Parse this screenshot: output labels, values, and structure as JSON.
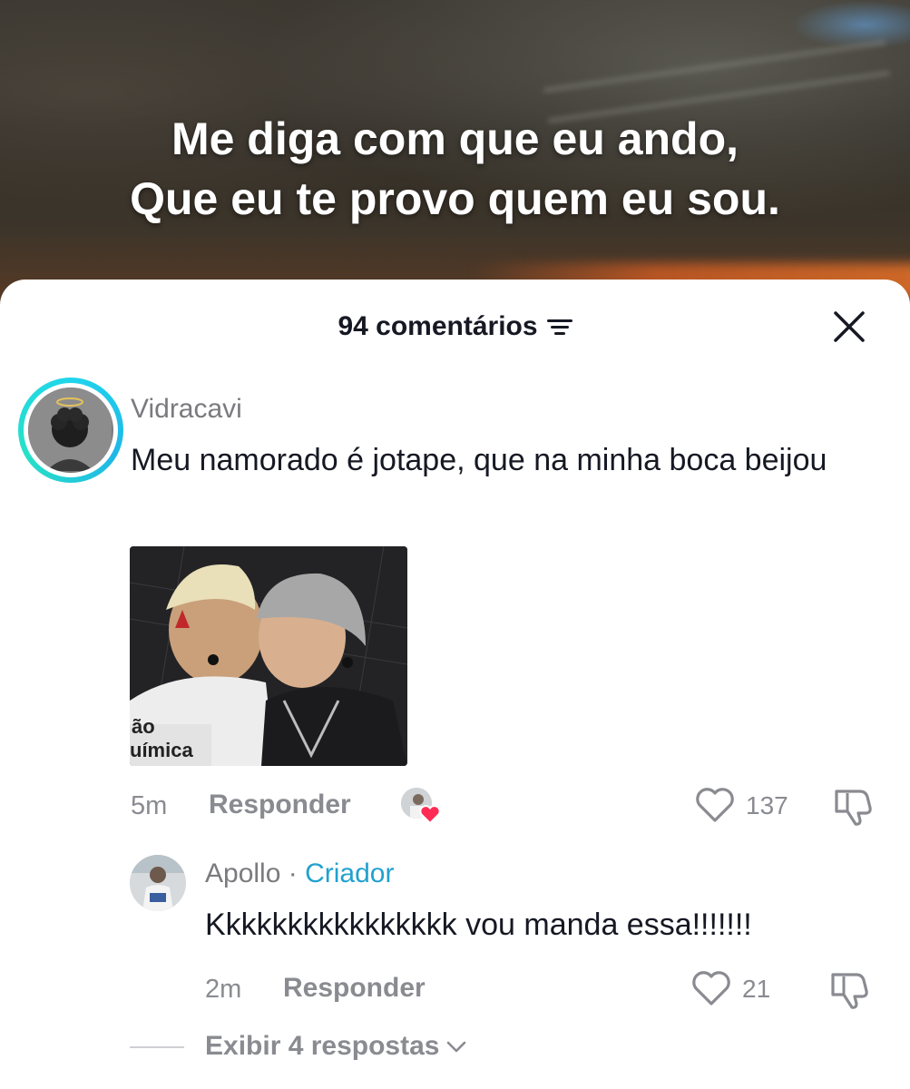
{
  "video": {
    "lyrics_line1": "Me diga com que eu ando,",
    "lyrics_line2": "Que eu te provo quem eu sou."
  },
  "sheet": {
    "comment_count": "94 comentários",
    "filter_icon": "filter-icon",
    "close_icon": "close-icon"
  },
  "comments": [
    {
      "username": "Vidracavi",
      "text": "Meu namorado é jotape, que na minha boca beijou",
      "time": "5m",
      "reply_label": "Responder",
      "likes": "137",
      "has_image": true,
      "liked_by_creator": true
    },
    {
      "username": "Apollo",
      "separator": "·",
      "badge": "Criador",
      "text": "Kkkkkkkkkkkkkkkk vou manda essa!!!!!!!",
      "time": "2m",
      "reply_label": "Responder",
      "likes": "21"
    }
  ],
  "view_replies": {
    "label": "Exibir 4 respostas"
  },
  "colors": {
    "text_primary": "#161823",
    "text_secondary": "#8a8b91",
    "creator_badge": "#21a1cf",
    "avatar_ring": "#20d5ec",
    "heart_red": "#fe2c55"
  }
}
